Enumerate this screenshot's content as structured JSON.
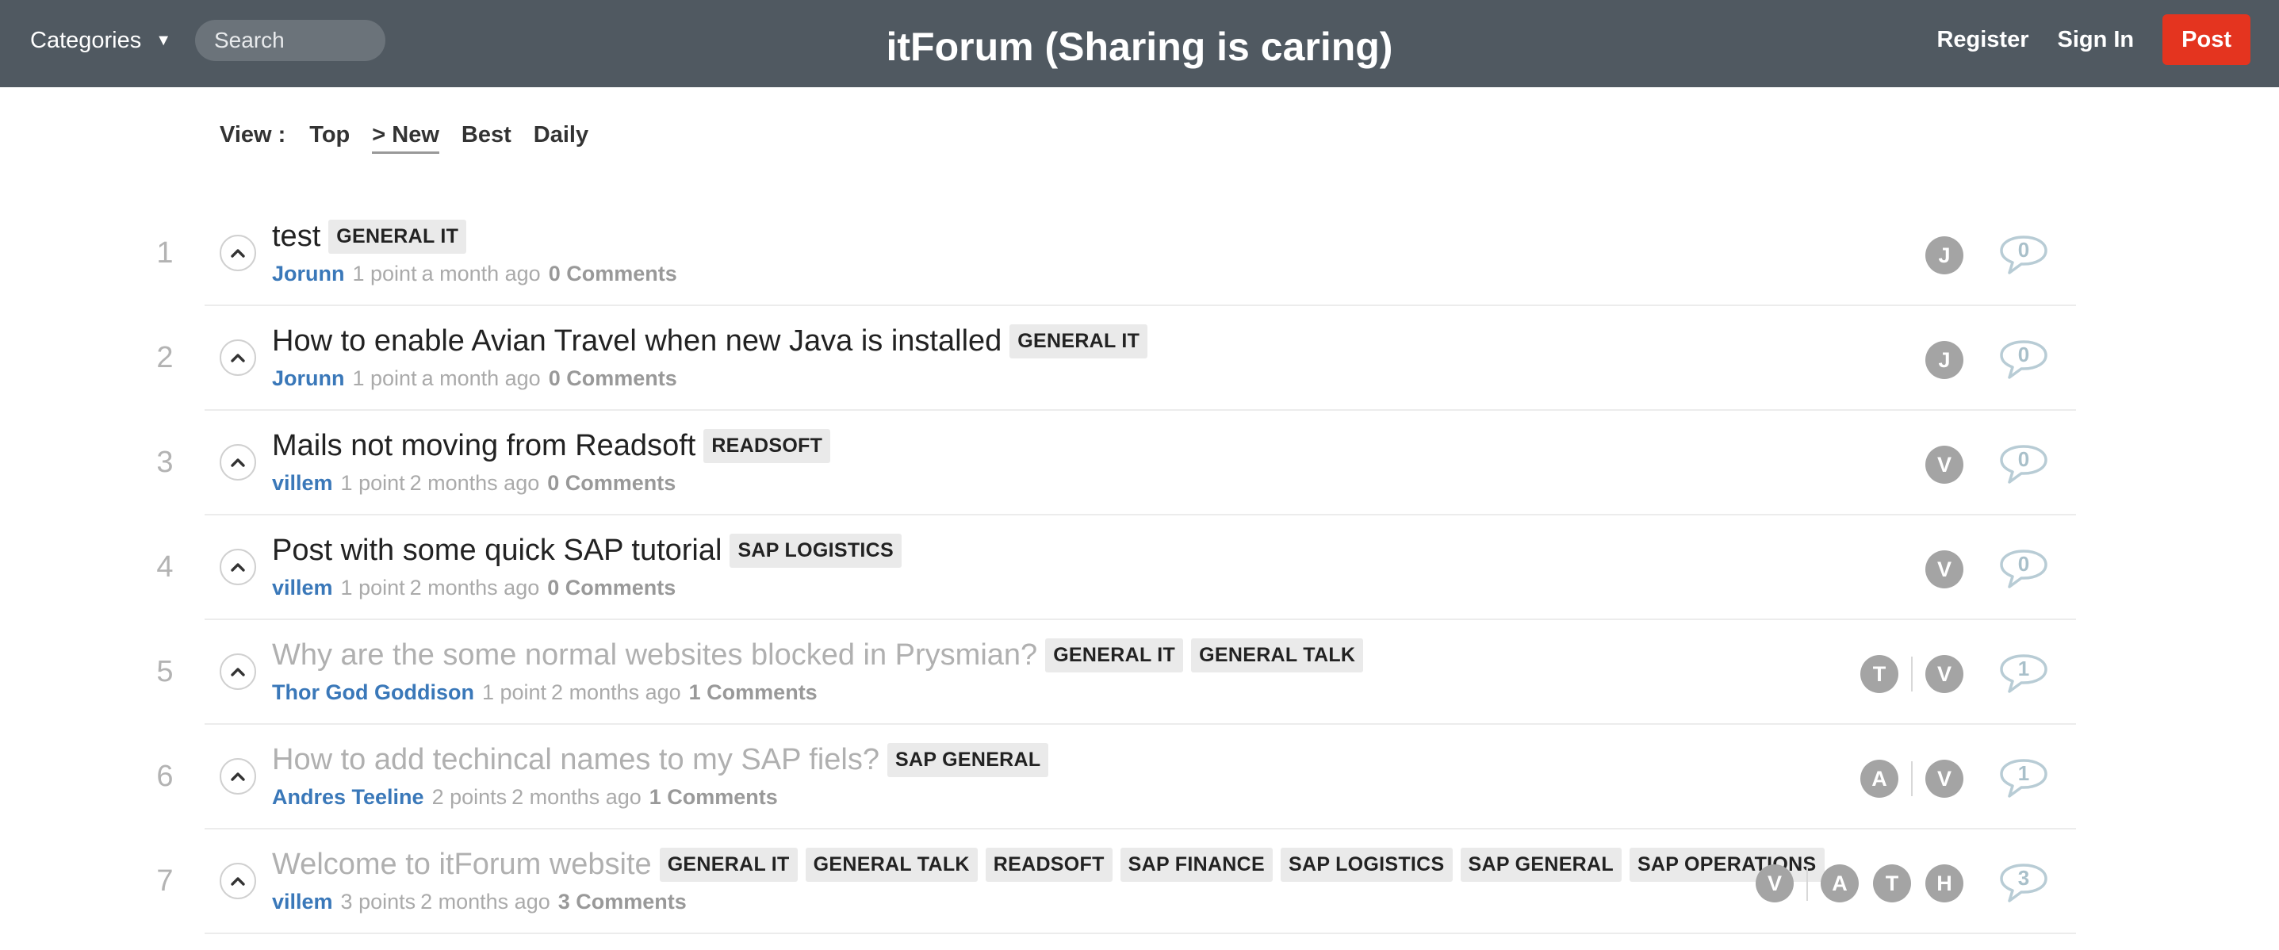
{
  "header": {
    "categories_label": "Categories",
    "search_placeholder": "Search",
    "site_title": "itForum (Sharing is caring)",
    "register_label": "Register",
    "signin_label": "Sign In",
    "post_label": "Post"
  },
  "view": {
    "label": "View :",
    "options": [
      {
        "label": "Top",
        "active": false
      },
      {
        "label": "> New",
        "active": true
      },
      {
        "label": "Best",
        "active": false
      },
      {
        "label": "Daily",
        "active": false
      }
    ]
  },
  "posts": [
    {
      "rank": "1",
      "title": "test",
      "visited": false,
      "tags": [
        "GENERAL IT"
      ],
      "author": "Jorunn",
      "points": "1 point",
      "ago": "a month ago",
      "comments": "0 Comments",
      "avatars": [
        "J"
      ],
      "comment_count": "0"
    },
    {
      "rank": "2",
      "title": "How to enable Avian Travel when new Java is installed",
      "visited": false,
      "tags": [
        "GENERAL IT"
      ],
      "author": "Jorunn",
      "points": "1 point",
      "ago": "a month ago",
      "comments": "0 Comments",
      "avatars": [
        "J"
      ],
      "comment_count": "0"
    },
    {
      "rank": "3",
      "title": "Mails not moving from Readsoft",
      "visited": false,
      "tags": [
        "READSOFT"
      ],
      "author": "villem",
      "points": "1 point",
      "ago": "2 months ago",
      "comments": "0 Comments",
      "avatars": [
        "V"
      ],
      "comment_count": "0"
    },
    {
      "rank": "4",
      "title": "Post with some quick SAP tutorial",
      "visited": false,
      "tags": [
        "SAP LOGISTICS"
      ],
      "author": "villem",
      "points": "1 point",
      "ago": "2 months ago",
      "comments": "0 Comments",
      "avatars": [
        "V"
      ],
      "comment_count": "0"
    },
    {
      "rank": "5",
      "title": "Why are the some normal websites blocked in Prysmian?",
      "visited": true,
      "tags": [
        "GENERAL IT",
        "GENERAL TALK"
      ],
      "author": "Thor God Goddison",
      "points": "1 point",
      "ago": "2 months ago",
      "comments": "1 Comments",
      "avatars": [
        "T",
        "V"
      ],
      "comment_count": "1"
    },
    {
      "rank": "6",
      "title": "How to add techincal names to my SAP fiels?",
      "visited": true,
      "tags": [
        "SAP GENERAL"
      ],
      "author": "Andres Teeline",
      "points": "2 points",
      "ago": "2 months ago",
      "comments": "1 Comments",
      "avatars": [
        "A",
        "V"
      ],
      "comment_count": "1"
    },
    {
      "rank": "7",
      "title": "Welcome to itForum website",
      "visited": true,
      "tags": [
        "GENERAL IT",
        "GENERAL TALK",
        "READSOFT",
        "SAP FINANCE",
        "SAP LOGISTICS",
        "SAP GENERAL",
        "SAP OPERATIONS"
      ],
      "author": "villem",
      "points": "3 points",
      "ago": "2 months ago",
      "comments": "3 Comments",
      "avatars": [
        "V",
        "A",
        "T",
        "H"
      ],
      "comment_count": "3"
    }
  ]
}
